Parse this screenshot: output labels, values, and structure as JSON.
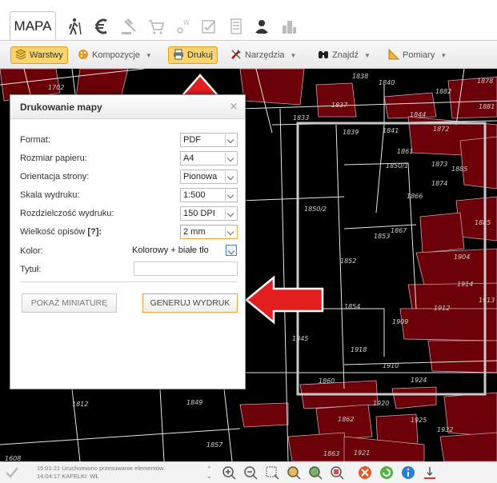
{
  "app": {
    "active_tab": "MAPA"
  },
  "tabs": [
    {
      "name": "hiking-icon"
    },
    {
      "name": "euro-icon"
    },
    {
      "name": "gavel-icon"
    },
    {
      "name": "cart-icon"
    },
    {
      "name": "compass-icon"
    },
    {
      "name": "checklist-icon"
    },
    {
      "name": "calculator-icon"
    },
    {
      "name": "user-icon"
    },
    {
      "name": "buildings-icon"
    }
  ],
  "toolbar": {
    "layers": "Warstwy",
    "compositions": "Kompozycje",
    "print": "Drukuj",
    "tools": "Narzędzia",
    "find": "Znajdź",
    "measure": "Pomiary"
  },
  "dialog": {
    "title": "Drukowanie mapy",
    "close": "×",
    "fields": [
      {
        "label": "Format:",
        "value": "PDF"
      },
      {
        "label": "Rozmiar papieru:",
        "value": "A4"
      },
      {
        "label": "Orientacja strony:",
        "value": "Pionowa"
      },
      {
        "label": "Skala wydruku:",
        "value": "1:500"
      },
      {
        "label": "Rozdzielczość wydruku:",
        "value": "150 DPI"
      },
      {
        "label": "Wielkość opisów",
        "label_extra": "[?]:",
        "value": "2 mm"
      },
      {
        "label": "Kolor:",
        "value": "Kolorowy + białe tło"
      },
      {
        "label": "Tytuł:",
        "value": ""
      }
    ],
    "preview_button": "POKAŻ MINIATURĘ",
    "generate_button": "GENERUJ WYDRUK"
  },
  "map": {
    "labels": [
      "1702",
      "1838",
      "1840",
      "1878",
      "1839",
      "1841",
      "1872",
      "1885",
      "1833",
      "1837",
      "1844",
      "1881",
      "1861",
      "1873",
      "1850/1",
      "1874",
      "1866",
      "1850/2",
      "1867",
      "1885",
      "1853",
      "1852",
      "1904",
      "1914",
      "1854",
      "1909",
      "1912",
      "1845",
      "1918",
      "1910",
      "1924",
      "1860",
      "1920",
      "1812",
      "1849",
      "1862",
      "1925",
      "1932",
      "1857",
      "1863",
      "1921",
      "1608",
      "1882",
      "1913"
    ]
  },
  "status": {
    "lines": [
      "15:01:21 Uruchomiono przesuwanie elementów.",
      "14:04:17 KAFELKI: WŁ"
    ]
  },
  "map_controls": [
    {
      "name": "zoom-in-icon"
    },
    {
      "name": "zoom-out-icon"
    },
    {
      "name": "zoom-extent-icon"
    },
    {
      "name": "zoom-prev-icon"
    },
    {
      "name": "zoom-next-icon"
    },
    {
      "name": "zoom-selection-icon"
    },
    {
      "name": "clear-icon"
    },
    {
      "name": "refresh-icon"
    },
    {
      "name": "info-icon"
    },
    {
      "name": "measure-tool-icon"
    }
  ],
  "colors": {
    "parcel_fill": "#6b0008",
    "parcel_stroke": "#d0a0b0",
    "highlight": "#fbd46f",
    "arrow_red": "#e31e1e",
    "frame": "#c8c8c8"
  }
}
